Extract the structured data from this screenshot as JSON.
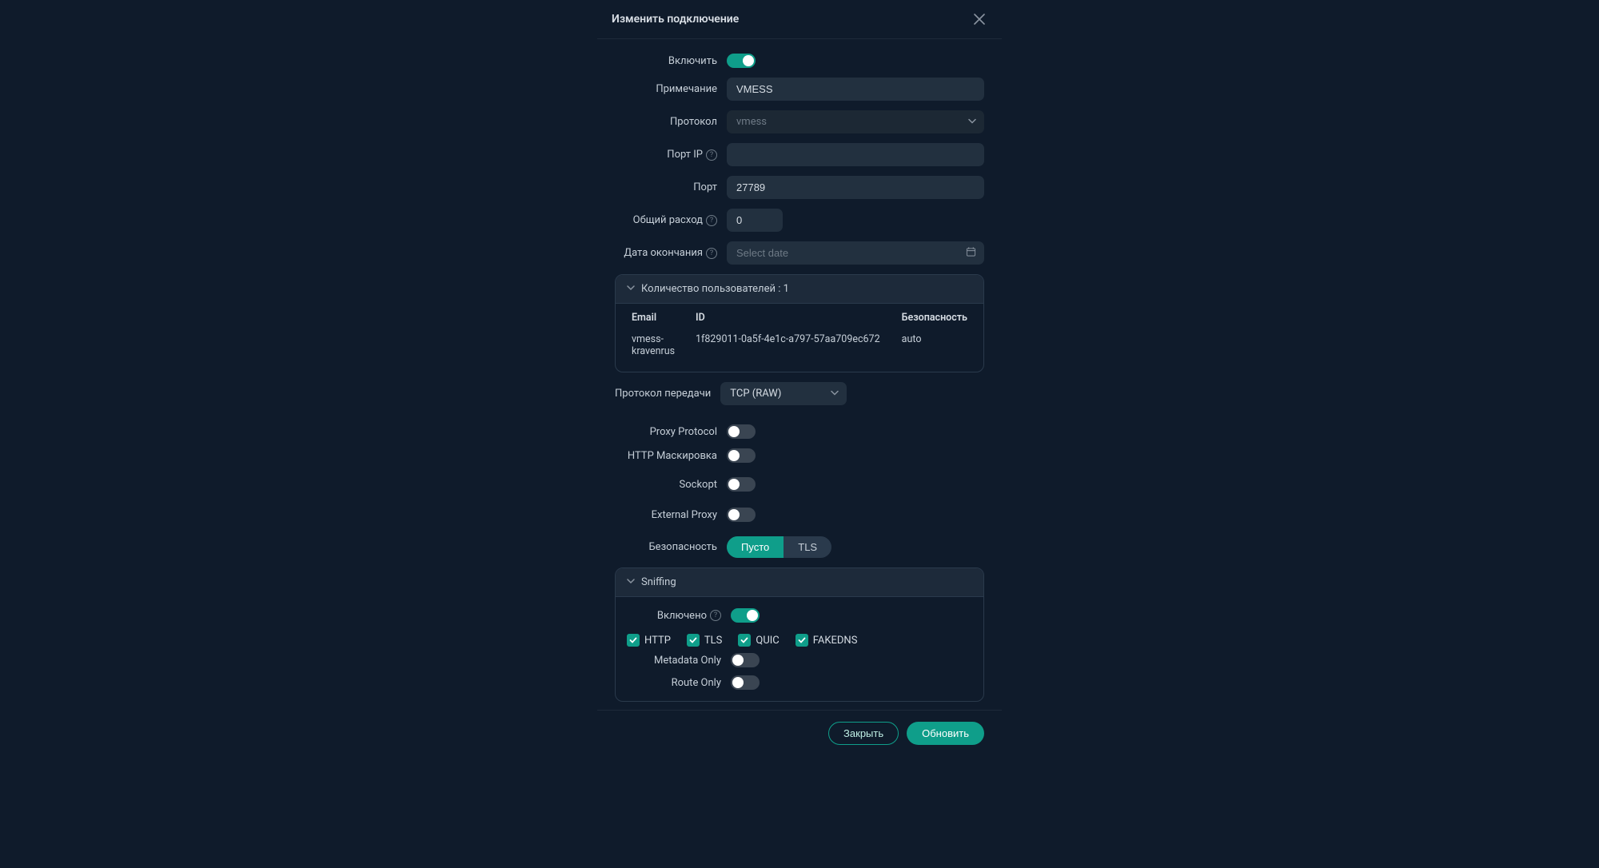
{
  "modal": {
    "title": "Изменить подключение"
  },
  "form": {
    "enable_label": "Включить",
    "remark_label": "Примечание",
    "remark_value": "VMESS",
    "protocol_label": "Протокол",
    "protocol_value": "vmess",
    "port_ip_label": "Порт IP",
    "port_ip_value": "",
    "port_label": "Порт",
    "port_value": "27789",
    "total_label": "Общий расход",
    "total_value": "0",
    "expire_label": "Дата окончания",
    "expire_placeholder": "Select date"
  },
  "users_panel": {
    "header": "Количество пользователей : 1",
    "cols": {
      "email": "Email",
      "id": "ID",
      "security": "Безопасность"
    },
    "row": {
      "email": "vmess-kravenrus",
      "id": "1f829011-0a5f-4e1c-a797-57aa709ec672",
      "security": "auto"
    }
  },
  "transport": {
    "label": "Протокол передачи",
    "value": "TCP (RAW)",
    "proxy_protocol_label": "Proxy Protocol",
    "http_mask_label": "HTTP Маскировка",
    "sockopt_label": "Sockopt",
    "external_proxy_label": "External Proxy",
    "security_label": "Безопасность",
    "seg_empty": "Пусто",
    "seg_tls": "TLS"
  },
  "sniffing": {
    "header": "Sniffing",
    "enabled_label": "Включено",
    "http": "HTTP",
    "tls": "TLS",
    "quic": "QUIC",
    "fakedns": "FAKEDNS",
    "metadata_label": "Metadata Only",
    "routeonly_label": "Route Only"
  },
  "footer": {
    "close": "Закрыть",
    "update": "Обновить"
  }
}
